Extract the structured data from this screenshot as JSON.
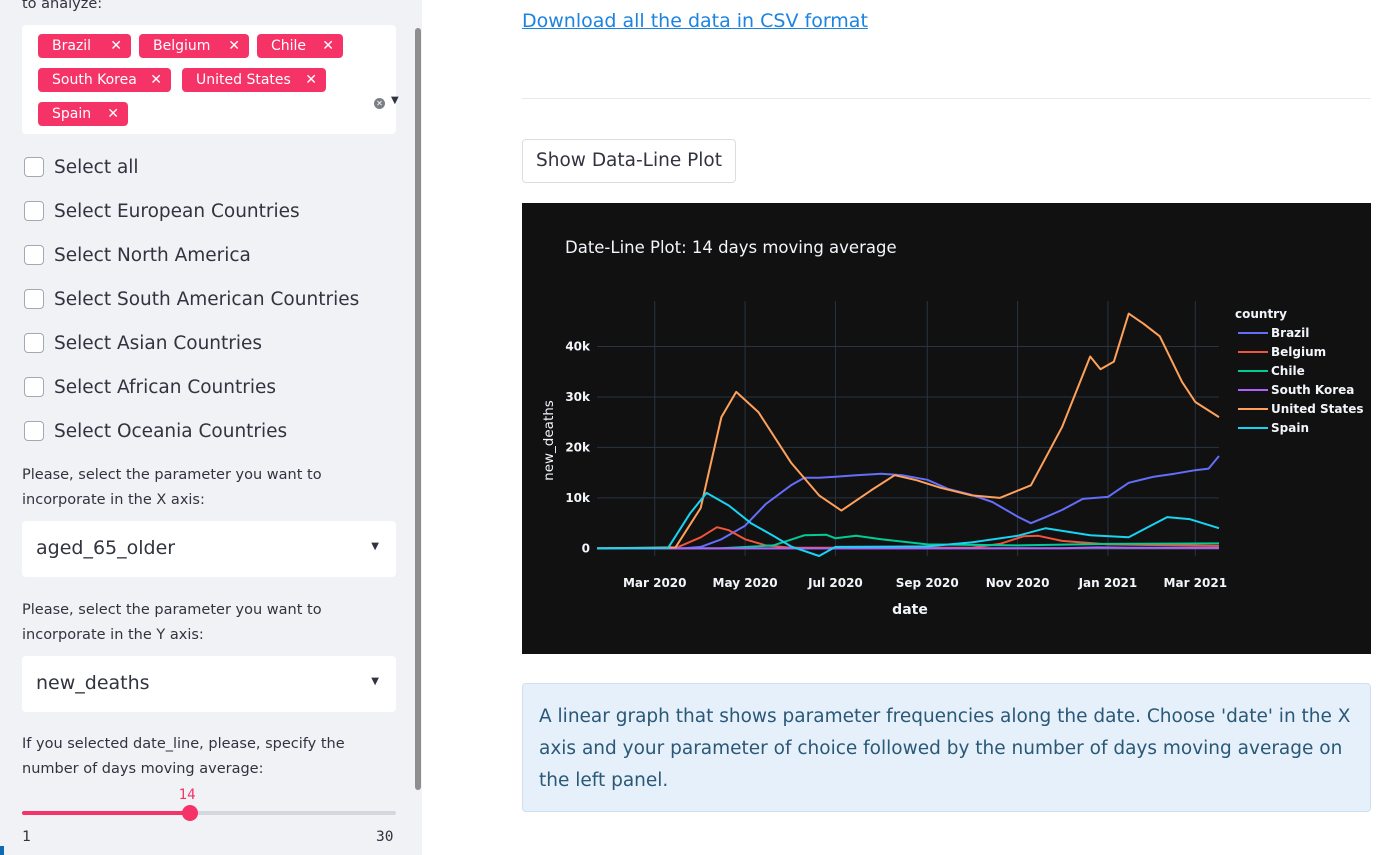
{
  "sidebar": {
    "multiselect_label": "to analyze:",
    "selected_countries": [
      "Brazil",
      "Belgium",
      "Chile",
      "South Korea",
      "United States",
      "Spain"
    ],
    "remove_glyph": "✕",
    "checkboxes": [
      "Select all",
      "Select European Countries",
      "Select North America",
      "Select South American Countries",
      "Select Asian Countries",
      "Select African Countries",
      "Select Oceania Countries"
    ],
    "x_axis_label": "Please, select the parameter you want to incorporate in the X axis:",
    "x_axis_value": "aged_65_older",
    "y_axis_label": "Please, select the parameter you want to incorporate in the Y axis:",
    "y_axis_value": "new_deaths",
    "moving_avg_label": "If you selected date_line, please, specify the number of days moving average:",
    "slider": {
      "value": 14,
      "min": 1,
      "max": 30
    }
  },
  "main": {
    "download_link": "Download all the data in CSV format",
    "show_plot_button": "Show Data-Line Plot",
    "info_text": "A linear graph that shows parameter frequencies along the date. Choose 'date' in the X axis and your parameter of choice followed by the number of days moving average on the left panel."
  },
  "colors": {
    "accent": "#f63366",
    "link": "#1c83e1",
    "chart_bg": "#111111",
    "info_bg": "#e5f0fa"
  },
  "chart_data": {
    "type": "line",
    "title": "Date-Line Plot: 14 days moving average",
    "xlabel": "date",
    "ylabel": "new_deaths",
    "legend_title": "country",
    "legend_position": "right",
    "grid": true,
    "x_ticks": [
      "2020-03-01",
      "2020-05-01",
      "2020-07-01",
      "2020-09-01",
      "2020-11-01",
      "2021-01-01",
      "2021-03-01"
    ],
    "x_tick_labels": [
      "Mar 2020",
      "May 2020",
      "Jul 2020",
      "Sep 2020",
      "Nov 2020",
      "Jan 2021",
      "Mar 2021"
    ],
    "y_ticks": [
      0,
      10000,
      20000,
      30000,
      40000
    ],
    "y_tick_labels": [
      "0",
      "10k",
      "20k",
      "30k",
      "40k"
    ],
    "xlim": [
      "2020-01-22",
      "2021-03-17"
    ],
    "ylim": [
      -1500,
      49000
    ],
    "series": [
      {
        "name": "Brazil",
        "color": "#636efa",
        "points": [
          [
            "2020-01-22",
            0
          ],
          [
            "2020-03-20",
            0
          ],
          [
            "2020-04-01",
            300
          ],
          [
            "2020-04-15",
            1800
          ],
          [
            "2020-05-01",
            4500
          ],
          [
            "2020-05-15",
            8800
          ],
          [
            "2020-06-01",
            12500
          ],
          [
            "2020-06-10",
            14000
          ],
          [
            "2020-06-20",
            14000
          ],
          [
            "2020-07-01",
            14200
          ],
          [
            "2020-07-15",
            14500
          ],
          [
            "2020-08-01",
            14800
          ],
          [
            "2020-08-15",
            14500
          ],
          [
            "2020-09-01",
            13600
          ],
          [
            "2020-09-15",
            11800
          ],
          [
            "2020-10-01",
            10600
          ],
          [
            "2020-10-15",
            9200
          ],
          [
            "2020-11-01",
            6300
          ],
          [
            "2020-11-10",
            5000
          ],
          [
            "2020-11-20",
            6200
          ],
          [
            "2020-12-01",
            7600
          ],
          [
            "2020-12-15",
            9800
          ],
          [
            "2021-01-01",
            10200
          ],
          [
            "2021-01-15",
            13000
          ],
          [
            "2021-02-01",
            14200
          ],
          [
            "2021-02-15",
            14800
          ],
          [
            "2021-03-01",
            15500
          ],
          [
            "2021-03-10",
            15800
          ],
          [
            "2021-03-17",
            18300
          ]
        ]
      },
      {
        "name": "Belgium",
        "color": "#ef553b",
        "points": [
          [
            "2020-01-22",
            0
          ],
          [
            "2020-03-15",
            50
          ],
          [
            "2020-04-01",
            2200
          ],
          [
            "2020-04-12",
            4200
          ],
          [
            "2020-04-20",
            3600
          ],
          [
            "2020-05-01",
            1800
          ],
          [
            "2020-05-15",
            600
          ],
          [
            "2020-06-01",
            150
          ],
          [
            "2020-10-01",
            150
          ],
          [
            "2020-10-20",
            900
          ],
          [
            "2020-11-05",
            2400
          ],
          [
            "2020-11-15",
            2500
          ],
          [
            "2020-12-01",
            1500
          ],
          [
            "2021-01-01",
            800
          ],
          [
            "2021-03-17",
            500
          ]
        ]
      },
      {
        "name": "Chile",
        "color": "#00cc96",
        "points": [
          [
            "2020-01-22",
            0
          ],
          [
            "2020-04-15",
            50
          ],
          [
            "2020-05-20",
            600
          ],
          [
            "2020-06-10",
            2600
          ],
          [
            "2020-06-25",
            2700
          ],
          [
            "2020-07-01",
            2000
          ],
          [
            "2020-07-15",
            2500
          ],
          [
            "2020-08-01",
            1800
          ],
          [
            "2020-09-01",
            800
          ],
          [
            "2020-11-01",
            600
          ],
          [
            "2021-01-01",
            900
          ],
          [
            "2021-03-17",
            1000
          ]
        ]
      },
      {
        "name": "South Korea",
        "color": "#ab63fa",
        "points": [
          [
            "2020-01-22",
            0
          ],
          [
            "2020-12-01",
            20
          ],
          [
            "2020-12-25",
            200
          ],
          [
            "2021-01-15",
            150
          ],
          [
            "2021-03-17",
            100
          ]
        ]
      },
      {
        "name": "United States",
        "color": "#ffa15a",
        "points": [
          [
            "2020-01-22",
            0
          ],
          [
            "2020-03-15",
            200
          ],
          [
            "2020-04-01",
            8000
          ],
          [
            "2020-04-15",
            26000
          ],
          [
            "2020-04-25",
            31000
          ],
          [
            "2020-05-10",
            27000
          ],
          [
            "2020-06-01",
            17000
          ],
          [
            "2020-06-20",
            10500
          ],
          [
            "2020-07-05",
            7500
          ],
          [
            "2020-07-25",
            11500
          ],
          [
            "2020-08-10",
            14500
          ],
          [
            "2020-08-25",
            13500
          ],
          [
            "2020-09-10",
            12000
          ],
          [
            "2020-10-01",
            10500
          ],
          [
            "2020-10-20",
            10000
          ],
          [
            "2020-11-10",
            12500
          ],
          [
            "2020-12-01",
            24000
          ],
          [
            "2020-12-20",
            38000
          ],
          [
            "2020-12-27",
            35500
          ],
          [
            "2021-01-05",
            37000
          ],
          [
            "2021-01-15",
            46500
          ],
          [
            "2021-01-25",
            44500
          ],
          [
            "2021-02-05",
            42000
          ],
          [
            "2021-02-20",
            33000
          ],
          [
            "2021-03-01",
            29000
          ],
          [
            "2021-03-17",
            26000
          ]
        ]
      },
      {
        "name": "Spain",
        "color": "#19d3f3",
        "points": [
          [
            "2020-01-22",
            0
          ],
          [
            "2020-03-10",
            100
          ],
          [
            "2020-03-25",
            7000
          ],
          [
            "2020-04-05",
            11000
          ],
          [
            "2020-04-20",
            8500
          ],
          [
            "2020-05-05",
            5000
          ],
          [
            "2020-05-20",
            2500
          ],
          [
            "2020-06-01",
            400
          ],
          [
            "2020-06-20",
            -1500
          ],
          [
            "2020-07-01",
            300
          ],
          [
            "2020-09-01",
            400
          ],
          [
            "2020-10-01",
            1200
          ],
          [
            "2020-11-01",
            2500
          ],
          [
            "2020-11-20",
            4000
          ],
          [
            "2020-12-20",
            2600
          ],
          [
            "2021-01-15",
            2200
          ],
          [
            "2021-02-10",
            6200
          ],
          [
            "2021-02-25",
            5800
          ],
          [
            "2021-03-17",
            4000
          ]
        ]
      }
    ]
  }
}
